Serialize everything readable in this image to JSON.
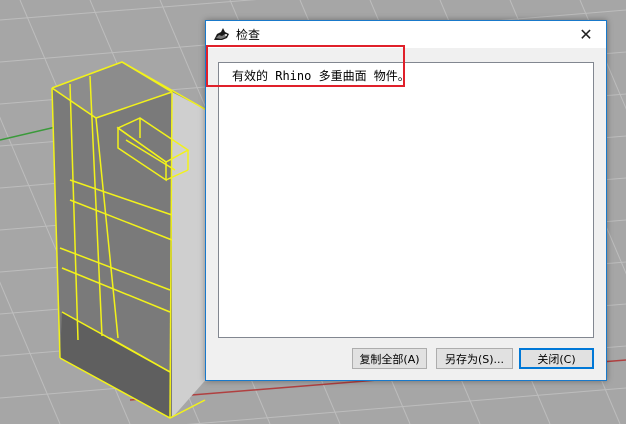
{
  "dialog": {
    "title": "检查",
    "report_text": "有效的 Rhino 多重曲面 物件。",
    "buttons": {
      "copy_all": "复制全部(A)",
      "save_as": "另存为(S)...",
      "close": "关闭(C)"
    }
  },
  "colors": {
    "viewport_bg": "#a6a6a6",
    "grid": "#bdbdbd",
    "selection": "#f2f21a",
    "highlight": "#e0202a",
    "accent": "#0078d7"
  },
  "icons": [
    "rhino-app-icon",
    "close-icon"
  ]
}
